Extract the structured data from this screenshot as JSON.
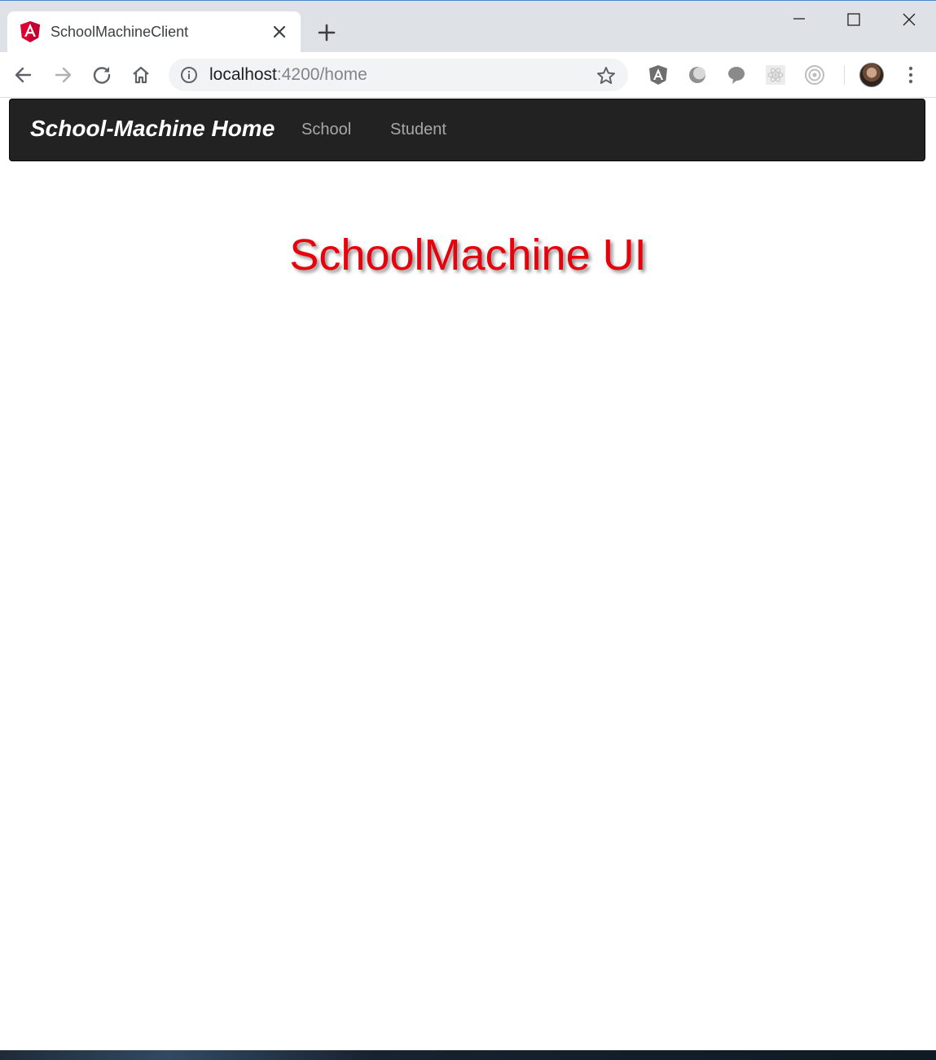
{
  "browser": {
    "tab": {
      "title": "SchoolMachineClient",
      "favicon": "angular-logo-icon"
    },
    "address_bar": {
      "host": "localhost",
      "path": ":4200/home"
    },
    "toolbar_icons": [
      "back-arrow-icon",
      "forward-arrow-icon",
      "reload-icon",
      "home-icon",
      "info-icon",
      "star-icon"
    ],
    "extension_icons": [
      "angular-shield-icon",
      "moon-icon",
      "chat-bubble-icon",
      "react-atom-icon",
      "target-icon"
    ],
    "window_controls": [
      "minimize-icon",
      "maximize-icon",
      "close-icon"
    ]
  },
  "navbar": {
    "brand": "School-Machine Home",
    "links": [
      {
        "label": "School"
      },
      {
        "label": "Student"
      }
    ]
  },
  "main": {
    "headline": "SchoolMachine UI"
  },
  "colors": {
    "navbar_bg": "#222222",
    "navlink": "#a8a8a8",
    "headline": "#e8000b",
    "tabstrip": "#dee1e6"
  }
}
